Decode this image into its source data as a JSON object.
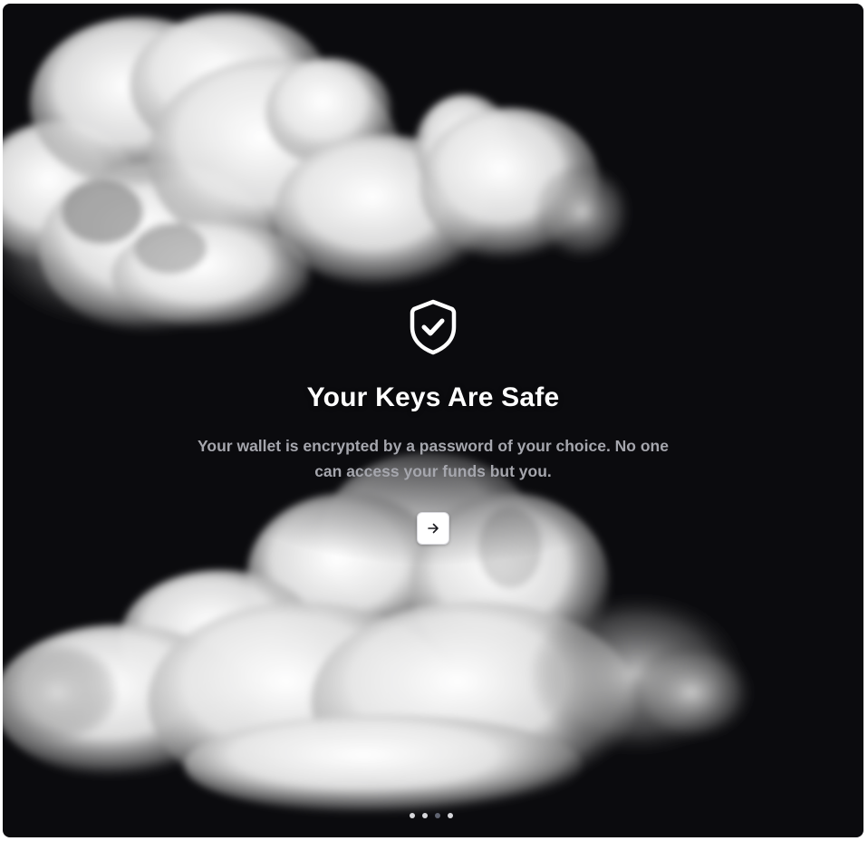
{
  "screen": {
    "title": "Your Keys Are Safe",
    "description": "Your wallet is encrypted by a password of your choice. No one can access your funds but you."
  },
  "icons": {
    "hero": "shield-check-icon",
    "next": "arrow-right-icon"
  },
  "pagination": {
    "total": 4,
    "active_index": 2
  },
  "colors": {
    "background": "#0b0b0e",
    "title": "#ffffff",
    "description": "#a5a6ad",
    "dot_inactive": "#d6d6da",
    "dot_active": "#5f6370"
  }
}
